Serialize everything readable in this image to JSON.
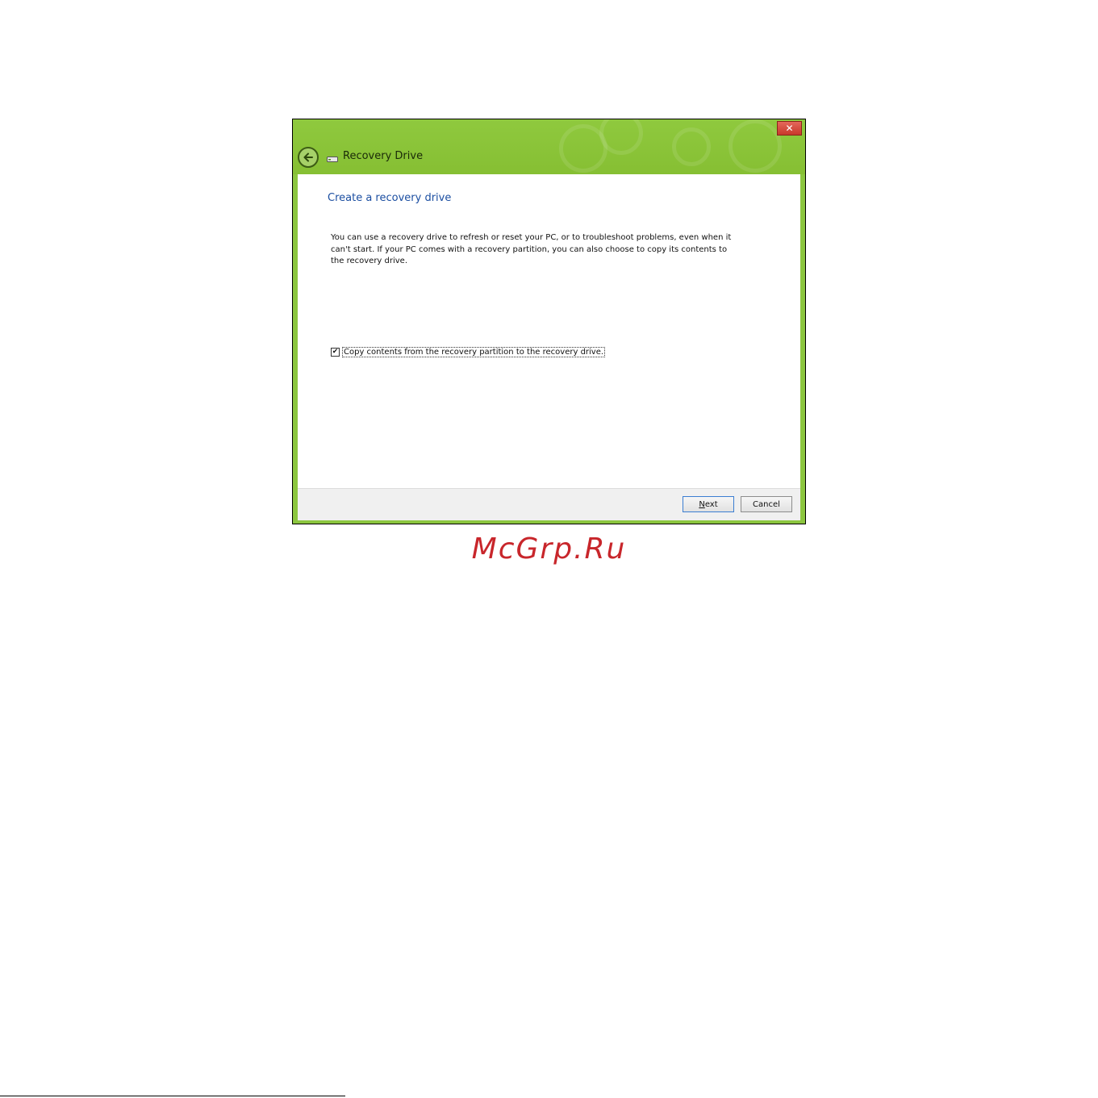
{
  "window": {
    "title": "Recovery Drive",
    "close_glyph": "✕",
    "back_icon": "back-arrow-icon",
    "drive_icon": "drive-icon"
  },
  "page": {
    "heading": "Create a recovery drive",
    "description": "You can use a recovery drive to refresh or reset your PC, or to troubleshoot problems, even when it can't start. If your PC comes with a recovery partition, you can also choose to copy its contents to the recovery drive.",
    "checkbox_label": "Copy contents from the recovery partition to the recovery drive.",
    "checkbox_checked": true,
    "checkbox_glyph": "✔"
  },
  "footer": {
    "next_mnemonic": "N",
    "next_rest": "ext",
    "cancel_label": "Cancel"
  },
  "watermark": "McGrp.Ru",
  "colors": {
    "titlebar": "#8cc63f",
    "heading": "#1b4ea1",
    "close": "#c8382b",
    "watermark": "#c8262b"
  }
}
